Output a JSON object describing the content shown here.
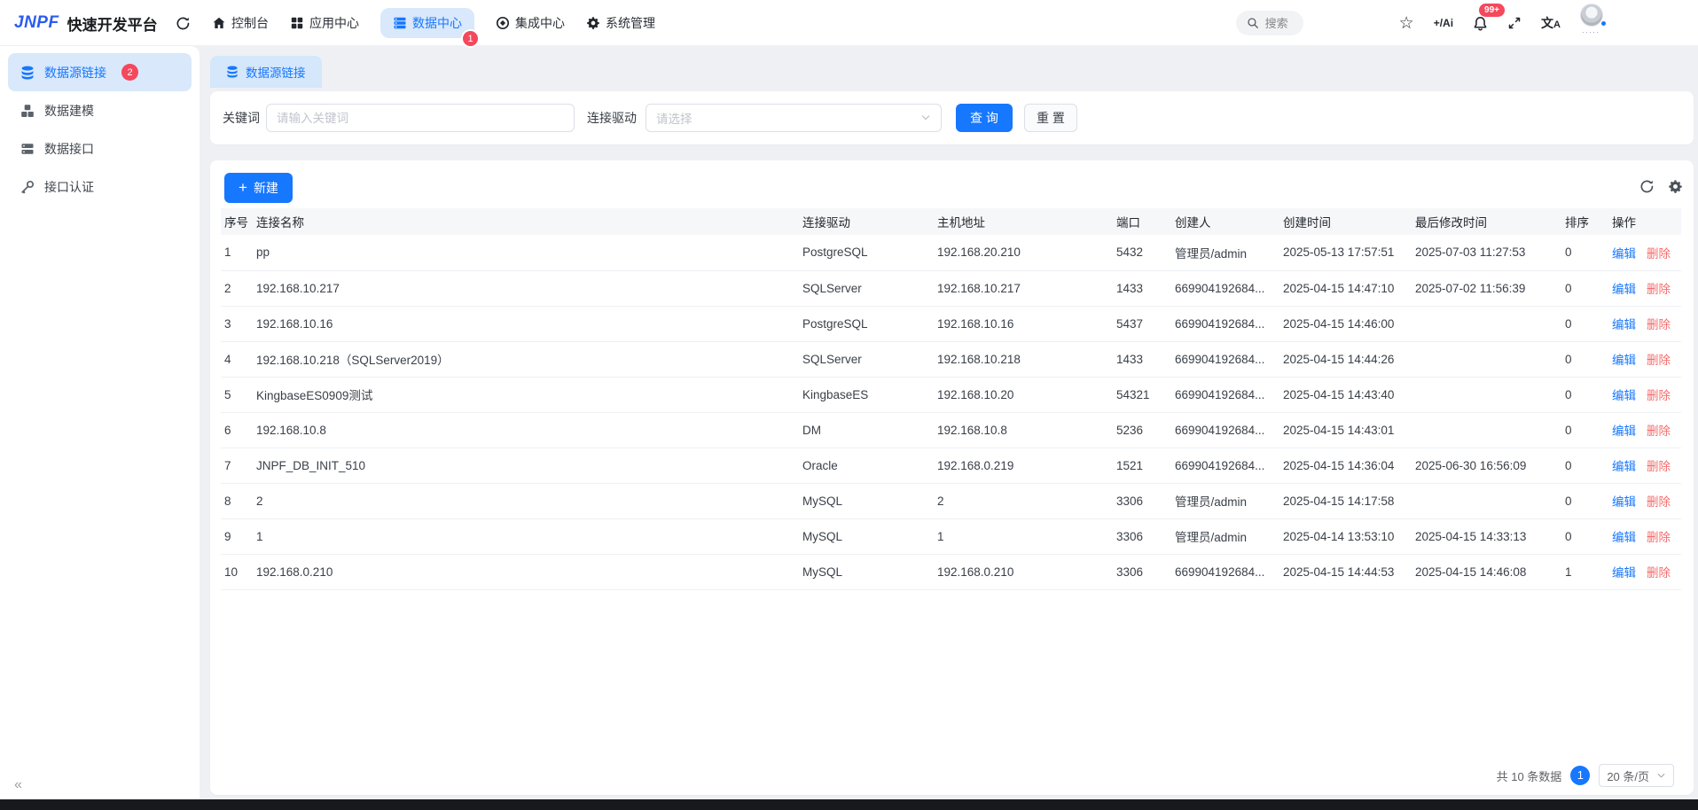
{
  "app": {
    "brand": "JNPF",
    "title": "快速开发平台"
  },
  "header": {
    "nav": [
      {
        "label": "控制台"
      },
      {
        "label": "应用中心"
      },
      {
        "label": "数据中心",
        "badge": "1"
      },
      {
        "label": "集成中心"
      },
      {
        "label": "系统管理"
      }
    ],
    "search_placeholder": "搜索",
    "ai_label": "+/Ai",
    "bell_badge": "99+",
    "star_glyph": "☆",
    "avatar_dots": "·····"
  },
  "sidebar": {
    "items": [
      {
        "label": "数据源链接",
        "badge": "2"
      },
      {
        "label": "数据建模"
      },
      {
        "label": "数据接口"
      },
      {
        "label": "接口认证"
      }
    ],
    "collapse": "«"
  },
  "tab": {
    "label": "数据源链接"
  },
  "filter": {
    "keyword_label": "关键词",
    "keyword_placeholder": "请输入关键词",
    "driver_label": "连接驱动",
    "driver_placeholder": "请选择",
    "search_button": "查 询",
    "reset_button": "重 置"
  },
  "toolbar": {
    "new_button": "新建"
  },
  "table": {
    "columns": [
      "序号",
      "连接名称",
      "连接驱动",
      "主机地址",
      "端口",
      "创建人",
      "创建时间",
      "最后修改时间",
      "排序",
      "操作"
    ],
    "edit_label": "编辑",
    "delete_label": "删除",
    "rows": [
      {
        "index": "1",
        "name": "pp",
        "driver": "PostgreSQL",
        "host": "192.168.20.210",
        "port": "5432",
        "creator": "管理员/admin",
        "created": "2025-05-13 17:57:51",
        "modified": "2025-07-03 11:27:53",
        "sort": "0"
      },
      {
        "index": "2",
        "name": "192.168.10.217",
        "driver": "SQLServer",
        "host": "192.168.10.217",
        "port": "1433",
        "creator": "669904192684...",
        "created": "2025-04-15 14:47:10",
        "modified": "2025-07-02 11:56:39",
        "sort": "0"
      },
      {
        "index": "3",
        "name": "192.168.10.16",
        "driver": "PostgreSQL",
        "host": "192.168.10.16",
        "port": "5437",
        "creator": "669904192684...",
        "created": "2025-04-15 14:46:00",
        "modified": "",
        "sort": "0"
      },
      {
        "index": "4",
        "name": "192.168.10.218（SQLServer2019）",
        "driver": "SQLServer",
        "host": "192.168.10.218",
        "port": "1433",
        "creator": "669904192684...",
        "created": "2025-04-15 14:44:26",
        "modified": "",
        "sort": "0"
      },
      {
        "index": "5",
        "name": "KingbaseES0909测试",
        "driver": "KingbaseES",
        "host": "192.168.10.20",
        "port": "54321",
        "creator": "669904192684...",
        "created": "2025-04-15 14:43:40",
        "modified": "",
        "sort": "0"
      },
      {
        "index": "6",
        "name": "192.168.10.8",
        "driver": "DM",
        "host": "192.168.10.8",
        "port": "5236",
        "creator": "669904192684...",
        "created": "2025-04-15 14:43:01",
        "modified": "",
        "sort": "0"
      },
      {
        "index": "7",
        "name": "JNPF_DB_INIT_510",
        "driver": "Oracle",
        "host": "192.168.0.219",
        "port": "1521",
        "creator": "669904192684...",
        "created": "2025-04-15 14:36:04",
        "modified": "2025-06-30 16:56:09",
        "sort": "0"
      },
      {
        "index": "8",
        "name": "2",
        "driver": "MySQL",
        "host": "2",
        "port": "3306",
        "creator": "管理员/admin",
        "created": "2025-04-15 14:17:58",
        "modified": "",
        "sort": "0"
      },
      {
        "index": "9",
        "name": "1",
        "driver": "MySQL",
        "host": "1",
        "port": "3306",
        "creator": "管理员/admin",
        "created": "2025-04-14 13:53:10",
        "modified": "2025-04-15 14:33:13",
        "sort": "0"
      },
      {
        "index": "10",
        "name": "192.168.0.210",
        "driver": "MySQL",
        "host": "192.168.0.210",
        "port": "3306",
        "creator": "669904192684...",
        "created": "2025-04-15 14:44:53",
        "modified": "2025-04-15 14:46:08",
        "sort": "1"
      }
    ]
  },
  "pagination": {
    "total": "共 10 条数据",
    "page": "1",
    "page_size": "20 条/页"
  },
  "colors": {
    "accent": "#1677ff",
    "accent-bg": "#d9e8fb",
    "badge": "#f4485d",
    "danger": "#f56c6c",
    "page-bg": "#eef0f4",
    "dark-strip": "#18191c",
    "tab-bg": "#d4e7fb"
  }
}
